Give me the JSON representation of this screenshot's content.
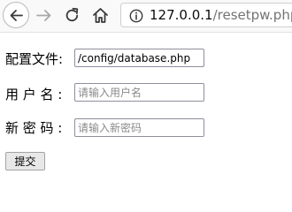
{
  "browser": {
    "url_host": "127.0.0.1",
    "url_path": "/resetpw.php"
  },
  "form": {
    "config_label": "配置文件:",
    "config_value": "/config/database.php",
    "username_label": "用 户 名 :",
    "username_placeholder": "请输入用户名",
    "password_label": "新 密 码 :",
    "password_placeholder": "请输入新密码",
    "submit_label": "提交"
  }
}
